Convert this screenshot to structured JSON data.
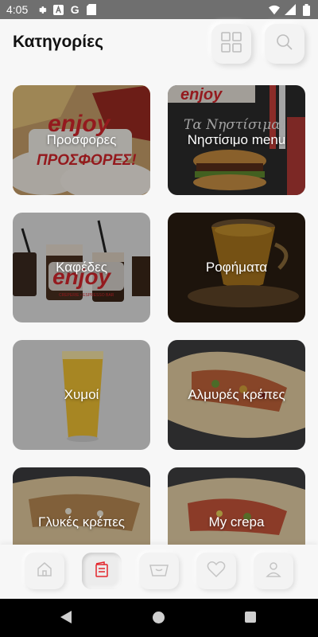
{
  "status_bar": {
    "time": "4:05",
    "left_icons": [
      "gear-icon",
      "a-letter-icon",
      "google-icon",
      "sd-card-icon"
    ],
    "right_icons": [
      "wifi-icon",
      "signal-icon",
      "battery-icon"
    ]
  },
  "header": {
    "title": "Κατηγορίες",
    "grid_icon": "grid-icon",
    "search_icon": "search-icon"
  },
  "categories": [
    {
      "label": "Προσφορες",
      "image": "enjoy-offers-sandwich"
    },
    {
      "label": "Νηστίσιμο menu",
      "image": "enjoy-lenten-burger"
    },
    {
      "label": "Καφέδες",
      "image": "enjoy-iced-coffees"
    },
    {
      "label": "Ροφήματα",
      "image": "tea-cup"
    },
    {
      "label": "Χυμοί",
      "image": "orange-juice-glass"
    },
    {
      "label": "Αλμυρές κρέπες",
      "image": "savory-crepe"
    },
    {
      "label": "Γλυκές κρέπες",
      "image": "sweet-crepe"
    },
    {
      "label": "My crepa",
      "image": "custom-crepe"
    }
  ],
  "bottom_nav": {
    "items": [
      "home-icon",
      "menu-icon",
      "basket-icon",
      "heart-icon",
      "user-icon"
    ],
    "active_index": 1,
    "active_color": "#e3242b"
  },
  "logo_text": "enjoy",
  "logo_subtitle": "CREPERIE • ESPRESSO BAR",
  "promo_text": "ΠΡΟΣΦΟΡΕΣ!",
  "lent_text": "Τα Νηστίσιμα!"
}
